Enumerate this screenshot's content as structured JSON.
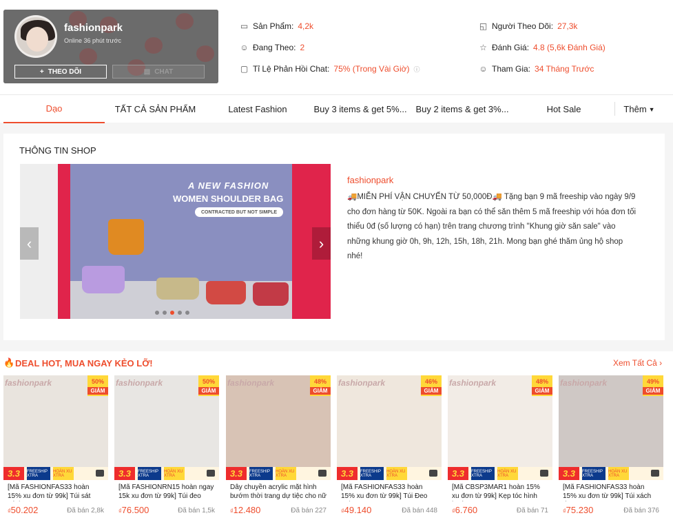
{
  "shop": {
    "name": "fashionpark",
    "online": "Online 36 phút trước",
    "follow_label": "THEO DÕI",
    "chat_label": "CHAT"
  },
  "stats": {
    "products_label": "Sản Phẩm:",
    "products_value": "4,2k",
    "following_label": "Đang Theo:",
    "following_value": "2",
    "chat_rate_label": "Tỉ Lệ Phản Hồi Chat:",
    "chat_rate_value": "75% (Trong Vài Giờ)",
    "followers_label": "Người Theo Dõi:",
    "followers_value": "27,3k",
    "rating_label": "Đánh Giá:",
    "rating_value": "4.8 (5,6k Đánh Giá)",
    "joined_label": "Tham Gia:",
    "joined_value": "34 Tháng Trước"
  },
  "tabs": [
    "Dạo",
    "TẤT CẢ SẢN PHẨM",
    "Latest Fashion",
    "Buy 3 items & get 5%...",
    "Buy 2 items & get 3%...",
    "Hot Sale",
    "Thêm"
  ],
  "info": {
    "title": "THÔNG TIN SHOP",
    "banner_line1": "A NEW FASHION",
    "banner_line2": "WOMEN SHOULDER BAG",
    "banner_line3": "CONTRACTED BUT NOT SIMPLE",
    "desc_name": "fashionpark",
    "description": "🚚MIỄN PHÍ VẬN CHUYỂN TỪ 50,000Đ🚚 Tặng bạn 9 mã freeship vào ngày 9/9 cho đơn hàng từ 50K. Ngoài ra bạn có thể săn thêm 5 mã freeship với hóa đơn tối thiểu 0đ (số lượng có hạn) trên trang chương trình \"Khung giờ săn sale\" vào những khung giờ 0h, 9h, 12h, 15h, 18h, 21h. Mong bạn ghé thăm ủng hộ shop nhé!"
  },
  "deal": {
    "title": "DEAL HOT, MUA NGAY KẺO LỠ!",
    "see_all": "Xem Tất Cả",
    "brand": "fashionpark",
    "badge_word": "GIẢM",
    "sale_tag": "3.3",
    "freeship_tag": "FREESHIP XTRA",
    "xu_tag": "HOÀN XU XTRA",
    "products": [
      {
        "name": "[Mã FASHIONFAS33 hoàn 15% xu đơn từ 99k] Túi sát nách m...",
        "price": "50.202",
        "sold": "Đã bán 2,8k",
        "discount": "50%"
      },
      {
        "name": "[Mã FASHIONRN15 hoàn ngay 15k xu đơn từ 99k] Túi đeo va...",
        "price": "76.500",
        "sold": "Đã bán 1,5k",
        "discount": "50%"
      },
      {
        "name": "Dây chuyền acrylic mặt hình bướm thời trang dự tiệc cho nữ",
        "price": "12.480",
        "sold": "Đã bán 227",
        "discount": "48%"
      },
      {
        "name": "[Mã FASHIONFAS33 hoàn 15% xu đơn từ 99k] Túi Đeo Vai In...",
        "price": "49.140",
        "sold": "Đã bán 448",
        "discount": "46%"
      },
      {
        "name": "[Mã CBSP3MAR1 hoàn 15% xu đơn từ 99k] Kẹp tóc hình bướ...",
        "price": "6.760",
        "sold": "Đã bán 71",
        "discount": "48%"
      },
      {
        "name": "[Mã FASHIONFAS33 hoàn 15% xu đơn từ 99k] Túi xách da P...",
        "price": "75.230",
        "sold": "Đã bán 376",
        "discount": "49%"
      }
    ]
  }
}
